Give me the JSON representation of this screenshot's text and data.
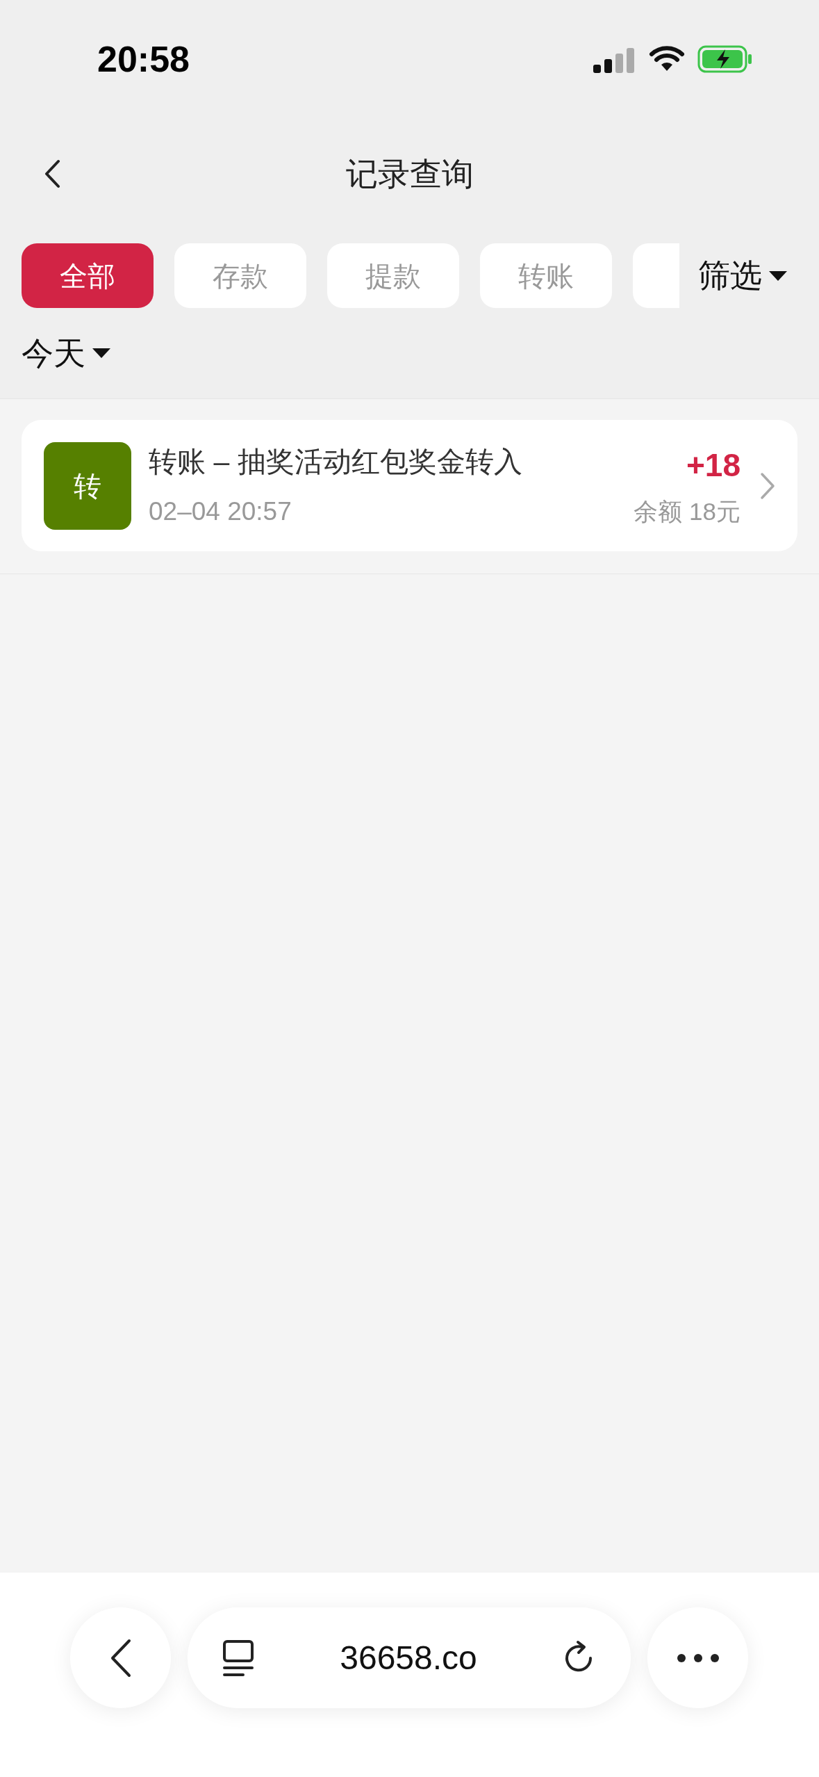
{
  "status_bar": {
    "time": "20:58",
    "battery": {
      "charging": true
    }
  },
  "header": {
    "title": "记录查询"
  },
  "tabs": [
    {
      "label": "全部",
      "selected": true
    },
    {
      "label": "存款",
      "selected": false
    },
    {
      "label": "提款",
      "selected": false
    },
    {
      "label": "转账",
      "selected": false
    },
    {
      "selected": false
    }
  ],
  "filter": {
    "label": "筛选"
  },
  "date_picker": {
    "label": "今天"
  },
  "records": [
    {
      "badge": "转",
      "color": "#568000",
      "title": "转账 – 抽奖活动红包奖金转入",
      "time": "02–04 20:57",
      "amount": "+18",
      "balance": "余额 18元"
    }
  ],
  "browser_bar": {
    "url": "36658.co"
  }
}
